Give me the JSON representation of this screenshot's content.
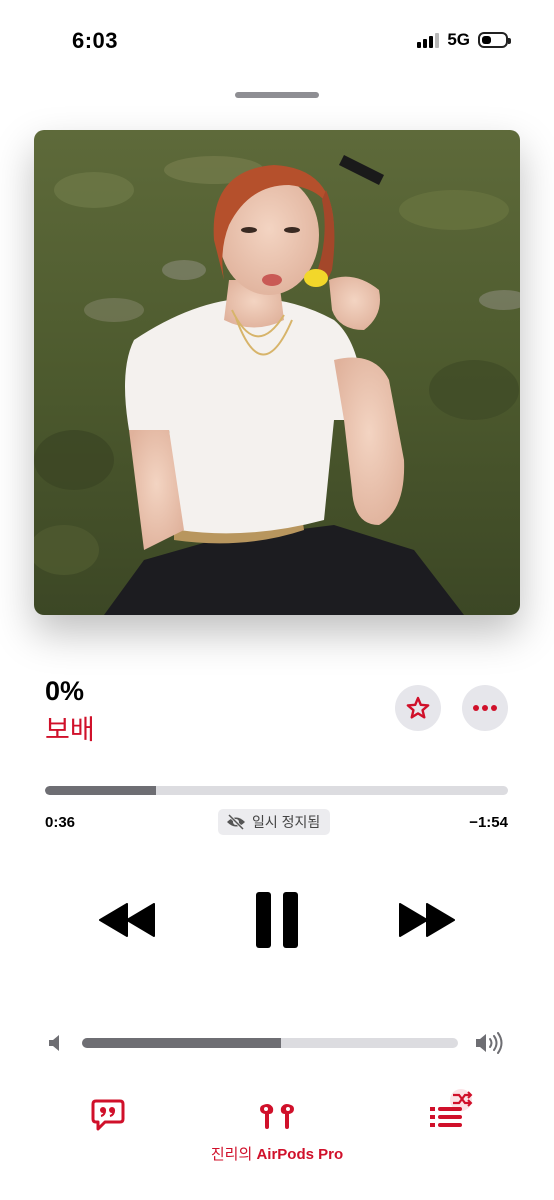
{
  "status_bar": {
    "time": "6:03",
    "network": "5G",
    "battery_level": 0.42
  },
  "now_playing": {
    "title": "0%",
    "artist": "보배",
    "artwork_icon": "album-artwork-photo"
  },
  "playback": {
    "progress": 0.24,
    "elapsed": "0:36",
    "remaining": "−1:54",
    "status": "일시 정지됨"
  },
  "volume": {
    "level": 0.53
  },
  "device": {
    "prefix": "진리의",
    "name": "AirPods Pro"
  },
  "colors": {
    "accent": "#d0102a",
    "track_fill": "#6e6e73",
    "track_bg": "#dcdce0",
    "button_bg": "#e6e6eb"
  },
  "icons": {
    "favorite": "star-icon",
    "more": "ellipsis-icon",
    "rewind": "rewind-icon",
    "pause": "pause-icon",
    "forward": "fast-forward-icon",
    "volume_low": "speaker-low-icon",
    "volume_high": "speaker-high-icon",
    "lyrics": "lyrics-quote-icon",
    "airplay": "airpods-icon",
    "queue": "queue-shuffle-icon"
  }
}
